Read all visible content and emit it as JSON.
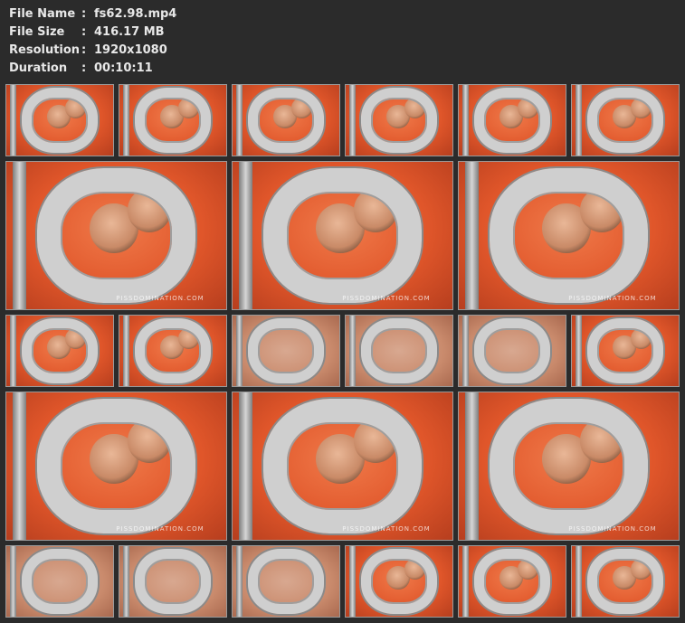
{
  "file_info": {
    "file_name_label": "File Name",
    "file_name_value": "fs62.98.mp4",
    "file_size_label": "File Size",
    "file_size_value": "416.17 MB",
    "resolution_label": "Resolution",
    "resolution_value": "1920x1080",
    "duration_label": "Duration",
    "duration_value": "00:10:11",
    "separator": ":"
  },
  "watermark": "PISSDOMINATION.COM",
  "colors": {
    "background": "#2b2b2b",
    "text": "#e8e8e8",
    "frame_border": "#9a9a9a"
  }
}
